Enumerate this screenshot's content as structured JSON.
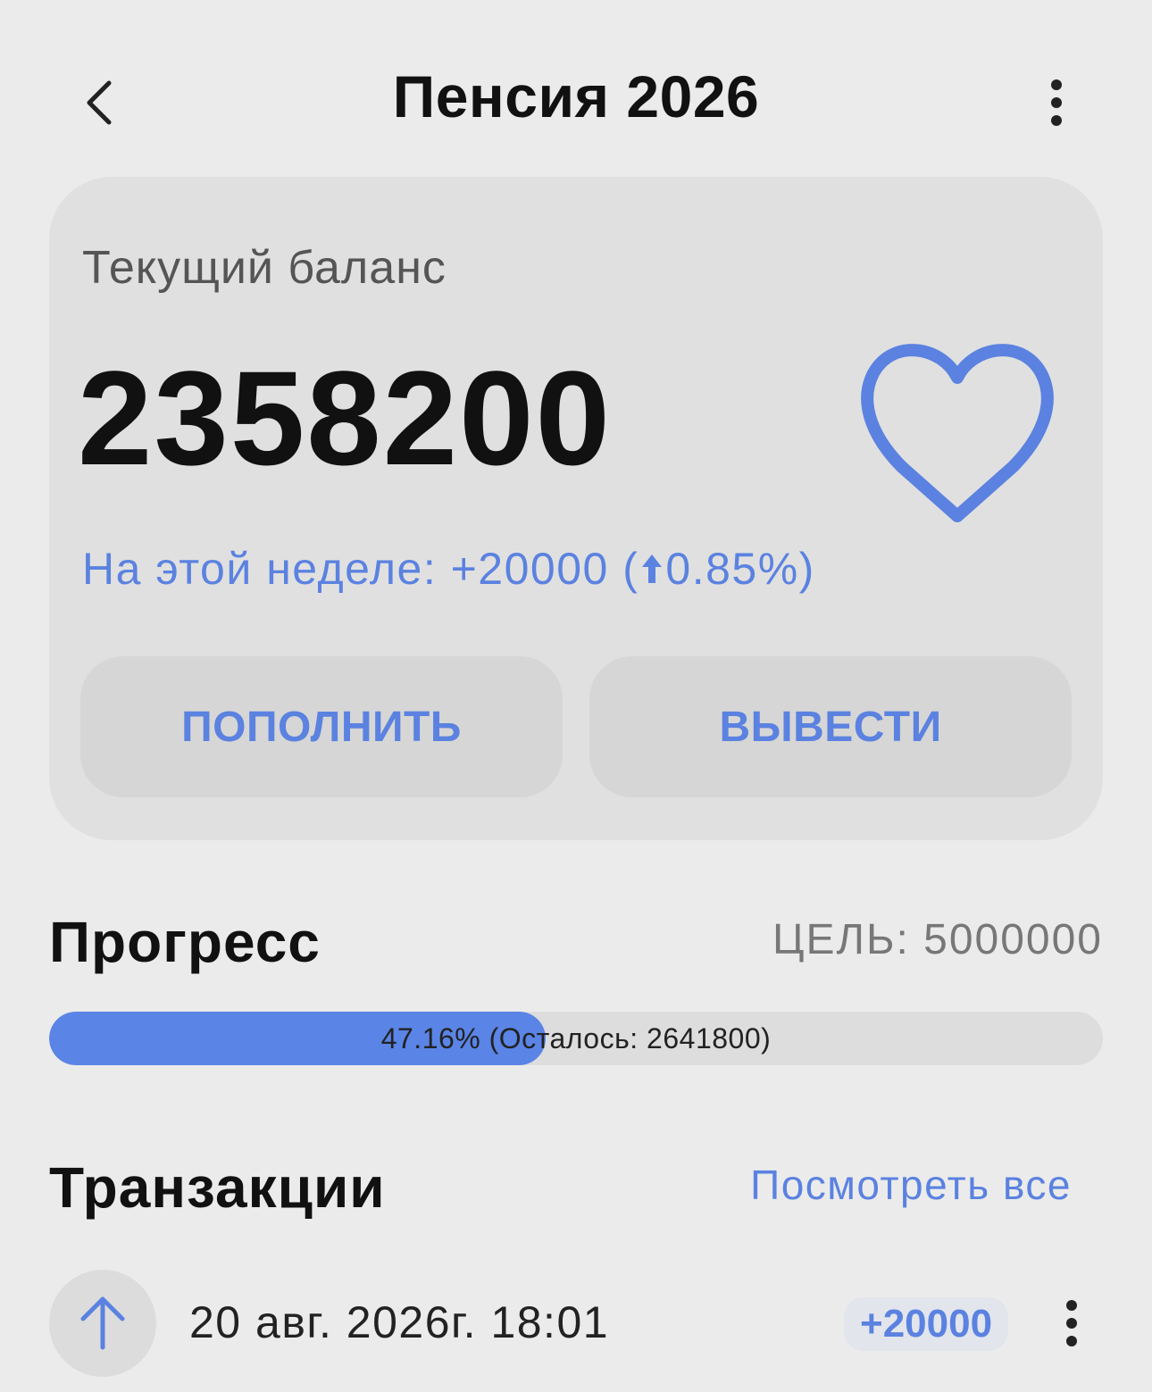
{
  "header": {
    "title": "Пенсия 2026",
    "back_icon": "chevron-left-icon",
    "more_icon": "more-vertical-icon"
  },
  "balance_card": {
    "label": "Текущий баланс",
    "value": "2358200",
    "favorite_icon": "heart-icon",
    "week_prefix": "На этой неделе: +20000 (",
    "week_arrow_icon": "arrow-up-icon",
    "week_percent": "0.85%)",
    "deposit_label": "ПОПОЛНИТЬ",
    "withdraw_label": "ВЫВЕСТИ"
  },
  "progress": {
    "title": "Прогресс",
    "goal": "ЦЕЛЬ: 5000000",
    "percent_value": 47.16,
    "text": "47.16% (Осталось: 2641800)"
  },
  "transactions": {
    "title": "Транзакции",
    "see_all": "Посмотреть все",
    "items": [
      {
        "icon": "arrow-up-icon",
        "date": "20 авг. 2026г. 18:01",
        "amount": "+20000",
        "more_icon": "more-vertical-icon"
      }
    ]
  },
  "colors": {
    "accent": "#5b82e0",
    "progress_fill": "#5a84e6",
    "background": "#ebebeb",
    "card": "#e0e0e0"
  }
}
